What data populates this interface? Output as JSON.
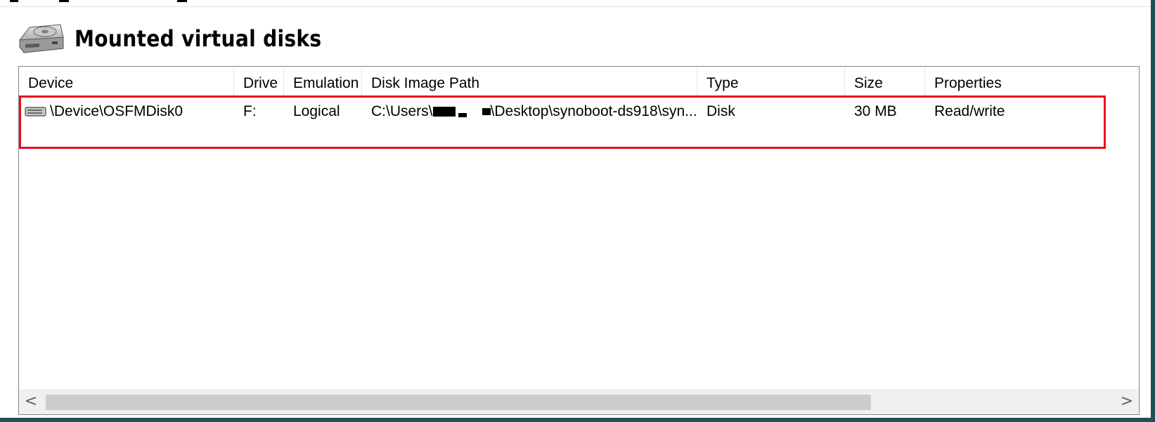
{
  "section": {
    "title": "Mounted virtual disks",
    "icon": "hard-disk-icon"
  },
  "table": {
    "columns": [
      "Device",
      "Drive",
      "Emulation",
      "Disk Image Path",
      "Type",
      "Size",
      "Properties"
    ],
    "rows": [
      {
        "device": "\\Device\\OSFMDisk0",
        "drive": "F:",
        "emulation": "Logical",
        "path_prefix": "C:\\Users\\",
        "path_suffix": "\\Desktop\\synoboot-ds918\\syn...",
        "type": "Disk",
        "size": "30 MB",
        "properties": "Read/write",
        "icon": "drive-icon"
      }
    ]
  },
  "scrollbar": {
    "left_arrow": "<",
    "right_arrow": ">"
  },
  "colors": {
    "highlight": "#e8101e",
    "border": "#828790"
  }
}
